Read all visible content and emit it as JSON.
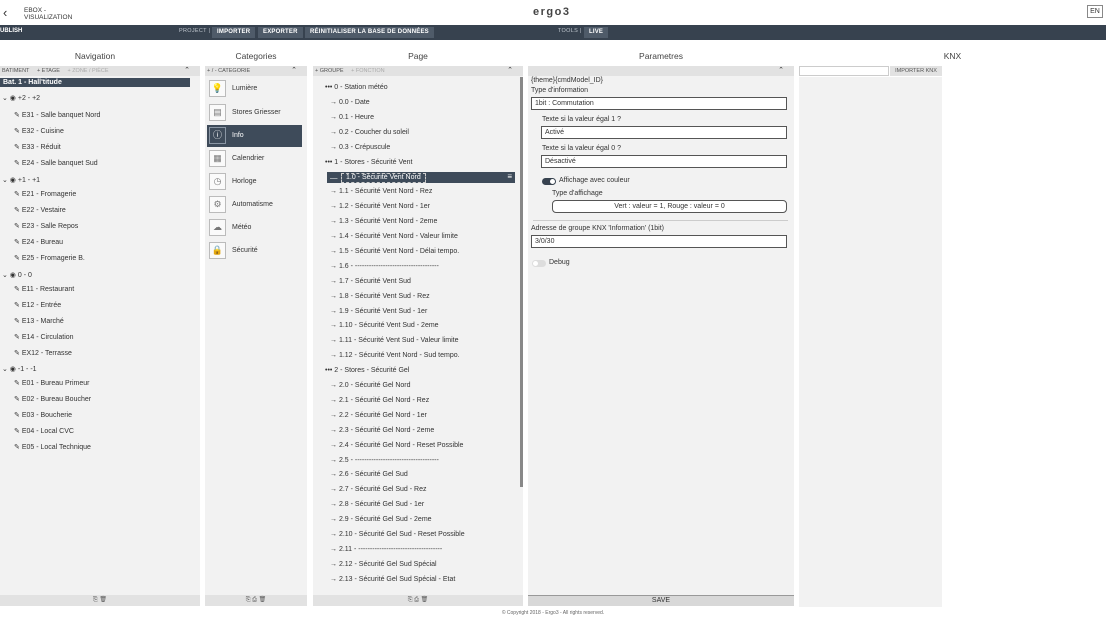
{
  "header": {
    "back_icon": "‹",
    "title_line1": "EBOX -",
    "title_line2": "VISUALIZATION",
    "logo": "ergo3",
    "lang": "EN"
  },
  "toolbar": {
    "publish": "UBLISH",
    "project_label": "PROJECT |",
    "importer": "IMPORTER",
    "exporter": "EXPORTER",
    "reset_db": "RÉINITIALISER LA BASE DE DONNÉES",
    "tools_label": "TOOLS |",
    "live": "LIVE"
  },
  "columns": {
    "navigation": "Navigation",
    "categories": "Categories",
    "page": "Page",
    "parametres": "Parametres",
    "knx": "KNX"
  },
  "navigation": {
    "head": [
      "BATIMENT",
      "+ ETAGE",
      "+ ZONE / PIÈCE"
    ],
    "items": [
      {
        "label": "Bat. 1 - Hall'titude",
        "level": 0
      },
      {
        "label": "+2 - +2",
        "level": 1
      },
      {
        "label": "E31 - Salle banquet Nord",
        "level": 2
      },
      {
        "label": "E32 - Cuisine",
        "level": 2
      },
      {
        "label": "E33 - Réduit",
        "level": 2
      },
      {
        "label": "E24 - Salle banquet Sud",
        "level": 2
      },
      {
        "label": "+1 - +1",
        "level": 1
      },
      {
        "label": "E21 - Fromagerie",
        "level": 2
      },
      {
        "label": "E22 - Vestaire",
        "level": 2
      },
      {
        "label": "E23 - Salle Repos",
        "level": 2
      },
      {
        "label": "E24 - Bureau",
        "level": 2
      },
      {
        "label": "E25 - Fromagerie B.",
        "level": 2
      },
      {
        "label": "0 - 0",
        "level": 1
      },
      {
        "label": "E11 - Restaurant",
        "level": 2
      },
      {
        "label": "E12 - Entrée",
        "level": 2
      },
      {
        "label": "E13 - Marché",
        "level": 2
      },
      {
        "label": "E14 - Circulation",
        "level": 2
      },
      {
        "label": "EX12 - Terrasse",
        "level": 2
      },
      {
        "label": "-1 - -1",
        "level": 1
      },
      {
        "label": "E01 - Bureau Primeur",
        "level": 2
      },
      {
        "label": "E02 - Bureau Boucher",
        "level": 2
      },
      {
        "label": "E03 - Boucherie",
        "level": 2
      },
      {
        "label": "E04 - Local CVC",
        "level": 2
      },
      {
        "label": "E05 - Local Technique",
        "level": 2
      }
    ],
    "foot": "⎘ 🗑"
  },
  "categories": {
    "head": "+ / - CATEGORIE",
    "items": [
      {
        "label": "Lumière",
        "icon": "💡"
      },
      {
        "label": "Stores Griesser",
        "icon": "▤"
      },
      {
        "label": "Info",
        "icon": "ⓘ"
      },
      {
        "label": "Calendrier",
        "icon": "▦"
      },
      {
        "label": "Horloge",
        "icon": "◷"
      },
      {
        "label": "Automatisme",
        "icon": "⚙"
      },
      {
        "label": "Météo",
        "icon": "☁"
      },
      {
        "label": "Sécurité",
        "icon": "🔒"
      }
    ],
    "foot": "⎘ ⎙ 🗑"
  },
  "page": {
    "head": [
      "+ GROUPE",
      "+ FONCTION"
    ],
    "items": [
      {
        "label": "••• 0 - Station météo",
        "group": true
      },
      {
        "label": "→ 0.0 - Date"
      },
      {
        "label": "→ 0.1 - Heure"
      },
      {
        "label": "→ 0.2 - Coucher du soleil"
      },
      {
        "label": "→ 0.3 - Crépuscule"
      },
      {
        "label": "••• 1 - Stores - Sécurité Vent",
        "group": true
      },
      {
        "label": "1.0 - Sécurité Vent Nord",
        "selected": true
      },
      {
        "label": "→ 1.1 - Sécurité Vent Nord - Rez"
      },
      {
        "label": "→ 1.2 - Sécurité Vent Nord - 1er"
      },
      {
        "label": "→ 1.3 - Sécurité Vent Nord - 2eme"
      },
      {
        "label": "→ 1.4 - Sécurité Vent Nord - Valeur limite"
      },
      {
        "label": "→ 1.5 - Sécurité Vent Nord - Délai tempo."
      },
      {
        "label": "→ 1.6 - ------------------------------------"
      },
      {
        "label": "→ 1.7 - Sécurité Vent Sud"
      },
      {
        "label": "→ 1.8 - Sécurité Vent Sud - Rez"
      },
      {
        "label": "→ 1.9 - Sécurité Vent Sud - 1er"
      },
      {
        "label": "→ 1.10 - Sécurité Vent Sud - 2eme"
      },
      {
        "label": "→ 1.11 - Sécurité Vent Sud - Valeur limite"
      },
      {
        "label": "→ 1.12 - Sécurité Vent Nord - Sud tempo."
      },
      {
        "label": "••• 2 - Stores - Sécurité Gel",
        "group": true
      },
      {
        "label": "→ 2.0 - Sécurité Gel Nord"
      },
      {
        "label": "→ 2.1 - Sécurité Gel Nord - Rez"
      },
      {
        "label": "→ 2.2 - Sécurité Gel Nord - 1er"
      },
      {
        "label": "→ 2.3 - Sécurité Gel Nord - 2eme"
      },
      {
        "label": "→ 2.4 - Sécurité Gel Nord - Reset Possible"
      },
      {
        "label": "→ 2.5 - ------------------------------------"
      },
      {
        "label": "→ 2.6 - Sécurité Gel Sud"
      },
      {
        "label": "→ 2.7 - Sécurité Gel Sud - Rez"
      },
      {
        "label": "→ 2.8 - Sécurité Gel Sud - 1er"
      },
      {
        "label": "→ 2.9 - Sécurité Gel Sud - 2eme"
      },
      {
        "label": "→ 2.10 - Sécurité Gel Sud - Reset Possible"
      },
      {
        "label": "→ 2.11 - ------------------------------------"
      },
      {
        "label": "→ 2.12 - Sécurité Gel Sud Spécial"
      },
      {
        "label": "→ 2.13 - Sécurité Gel Sud Spécial - Etat"
      }
    ],
    "foot": "⎘ ⎙ 🗑"
  },
  "parametres": {
    "theme_path": "{theme}{cmdModel_ID}",
    "type_label": "Type d'information",
    "type_value": "1bit : Commutation",
    "text1_label": "Texte si la valeur égal 1 ?",
    "text1_value": "Activé",
    "text0_label": "Texte si la valeur égal 0 ?",
    "text0_value": "Désactivé",
    "color_label": "Affichage avec couleur",
    "display_type_label": "Type d'affichage",
    "display_type_value": "Vert : valeur = 1, Rouge : valeur = 0",
    "knx_addr_label": "Adresse de groupe KNX 'Information' (1bit)",
    "knx_addr_value": "3/0/30",
    "debug_label": "Debug",
    "save": "SAVE"
  },
  "knx": {
    "import_btn": "IMPORTER KNX"
  },
  "footer": {
    "copyright": "© Copyright 2018 - Ergo3 - All rights reserved."
  }
}
